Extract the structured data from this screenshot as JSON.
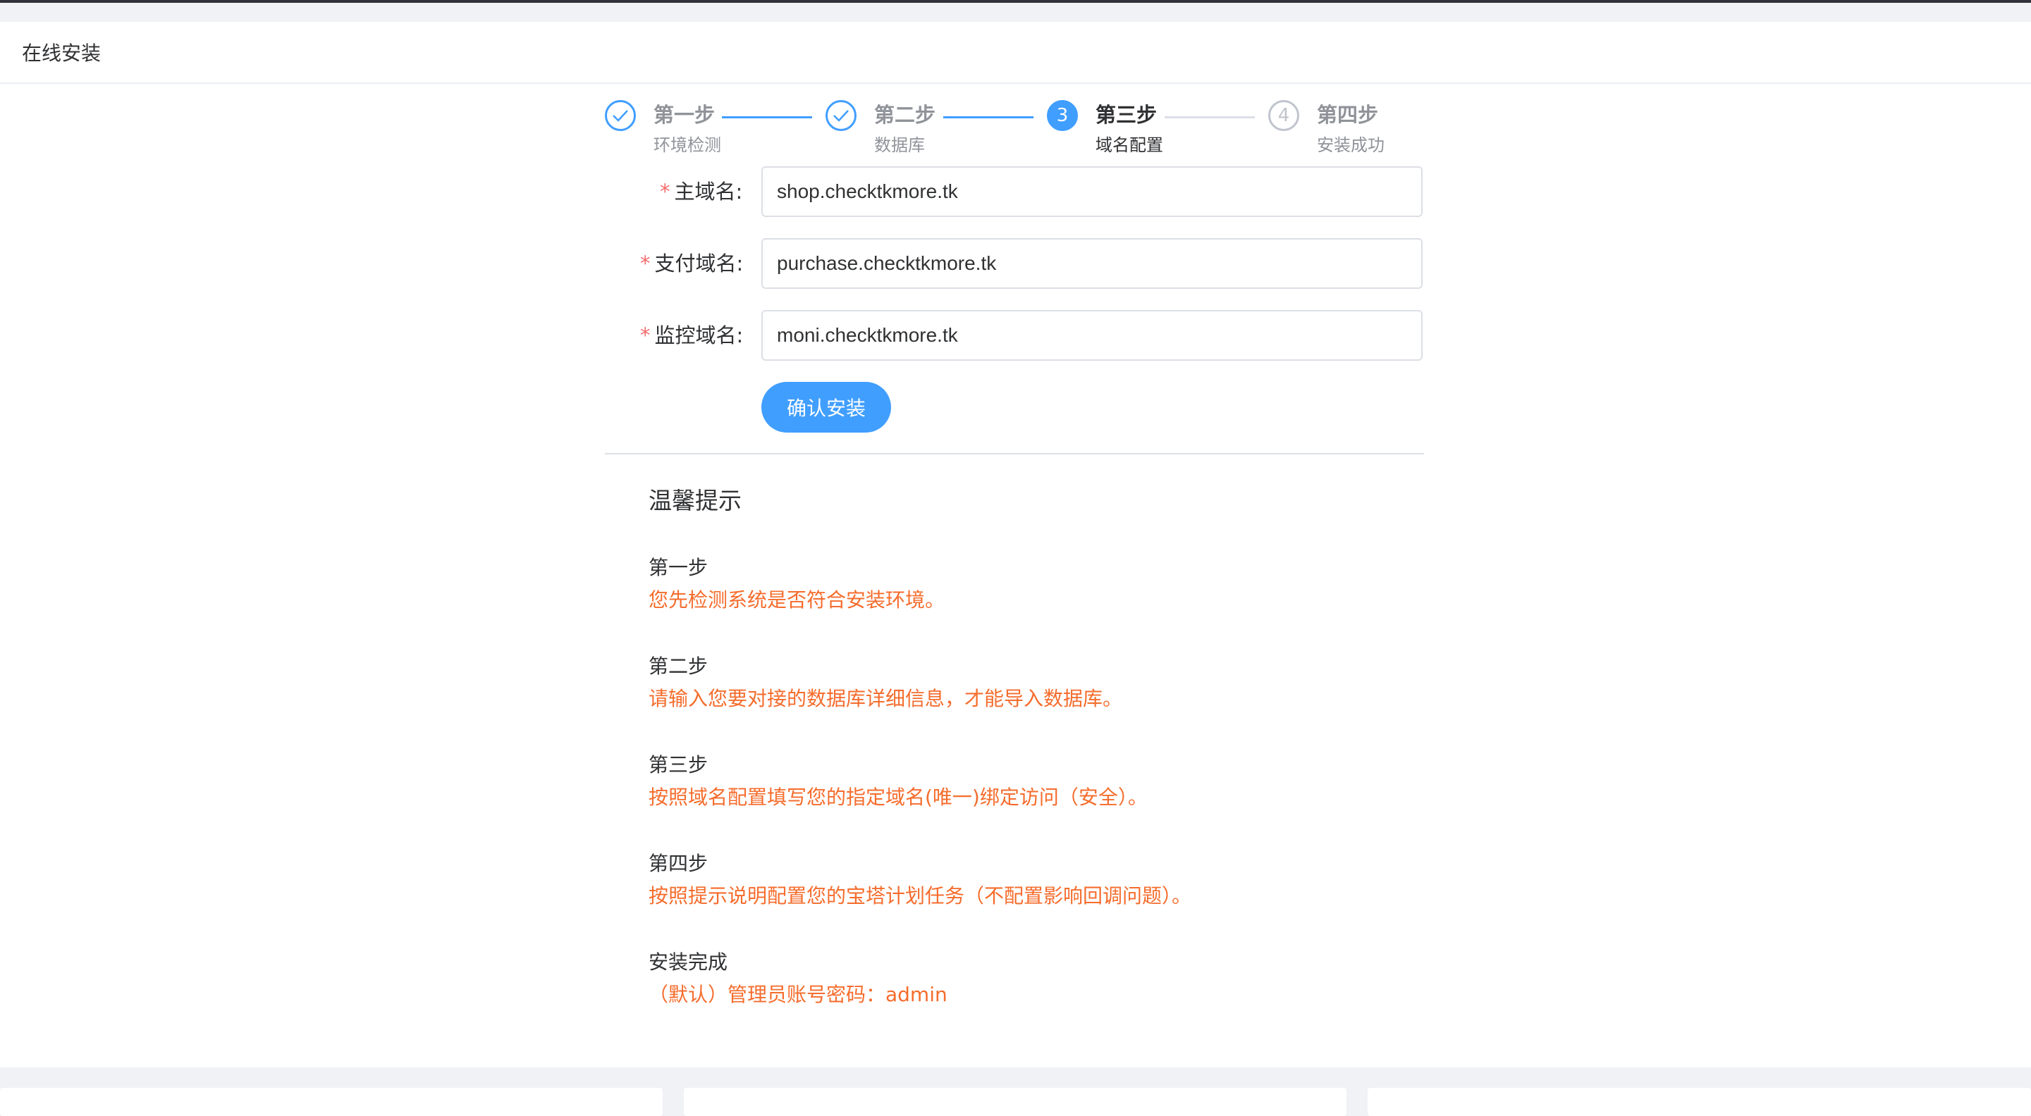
{
  "header": {
    "title": "在线安装"
  },
  "steps": [
    {
      "title": "第一步",
      "desc": "环境检测",
      "status": "done",
      "icon": "check-icon"
    },
    {
      "title": "第二步",
      "desc": "数据库",
      "status": "done",
      "icon": "check-icon"
    },
    {
      "title": "第三步",
      "desc": "域名配置",
      "status": "active",
      "number": "3"
    },
    {
      "title": "第四步",
      "desc": "安装成功",
      "status": "wait",
      "number": "4"
    }
  ],
  "form": {
    "fields": [
      {
        "label": "主域名:",
        "value": "shop.checktkmore.tk",
        "required": "*"
      },
      {
        "label": "支付域名:",
        "value": "purchase.checktkmore.tk",
        "required": "*"
      },
      {
        "label": "监控域名:",
        "value": "moni.checktkmore.tk",
        "required": "*"
      }
    ],
    "submit_label": "确认安装"
  },
  "tips": {
    "title": "温馨提示",
    "items": [
      {
        "step": "第一步",
        "text": "您先检测系统是否符合安装环境。"
      },
      {
        "step": "第二步",
        "text": "请输入您要对接的数据库详细信息，才能导入数据库。"
      },
      {
        "step": "第三步",
        "text": "按照域名配置填写您的指定域名(唯一)绑定访问（安全）。"
      },
      {
        "step": "第四步",
        "text": "按照提示说明配置您的宝塔计划任务（不配置影响回调问题）。"
      },
      {
        "step": "安装完成",
        "text": "（默认）管理员账号密码：admin"
      }
    ]
  },
  "colors": {
    "primary": "#409eff",
    "warning_text": "#f56c2c",
    "required": "#f56c6c"
  }
}
